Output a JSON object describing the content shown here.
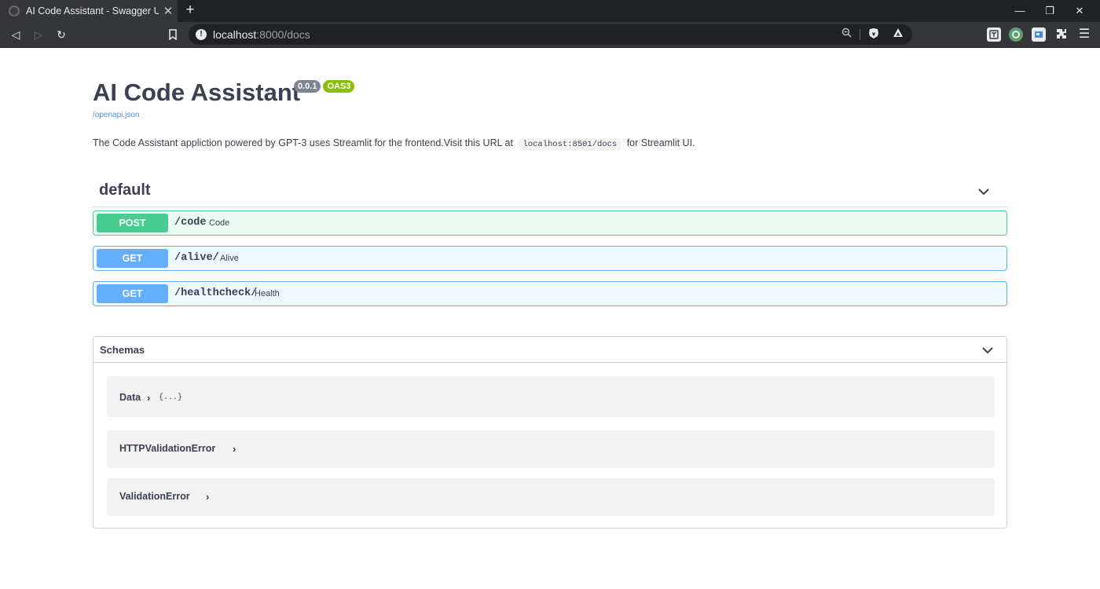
{
  "browser": {
    "tab_title": "AI Code Assistant - Swagger UI",
    "tab_close": "✕",
    "new_tab": "+",
    "url_host": "localhost",
    "url_rest": ":8000/docs",
    "window_controls": {
      "minimize": "—",
      "restore": "❐",
      "close": "✕"
    }
  },
  "info": {
    "title": "AI Code Assistant",
    "version": "0.0.1",
    "oas": "OAS3",
    "spec_link": "/openapi.json",
    "description_before": "The Code Assistant appliction powered by GPT-3 uses Streamlit for the frontend.Visit this URL at",
    "description_code": "localhost:8501/docs",
    "description_after": "for Streamlit UI."
  },
  "tag_section": {
    "name": "default",
    "operations": [
      {
        "method": "POST",
        "path": "/code",
        "summary": "Code"
      },
      {
        "method": "GET",
        "path": "/alive/",
        "summary": "Alive"
      },
      {
        "method": "GET",
        "path": "/healthcheck/",
        "summary": "Health"
      }
    ]
  },
  "schemas": {
    "title": "Schemas",
    "models": [
      {
        "name": "Data",
        "arrow": "›",
        "braces": "{...}"
      },
      {
        "name": "HTTPValidationError",
        "arrow": "›"
      },
      {
        "name": "ValidationError",
        "arrow": "›"
      }
    ]
  },
  "colors": {
    "post": "#49cc90",
    "get": "#61affe",
    "text": "#3b4151",
    "version_badge": "#7d8492",
    "oas_badge": "#89bf04"
  },
  "icons": [
    "info-icon",
    "bookmark-icon",
    "reload-icon",
    "back-icon",
    "forward-icon",
    "zoom-icon",
    "brave-shield-icon",
    "rewards-icon",
    "extensions-icon",
    "menu-icon",
    "chevron-down-icon",
    "chevron-right-icon"
  ]
}
